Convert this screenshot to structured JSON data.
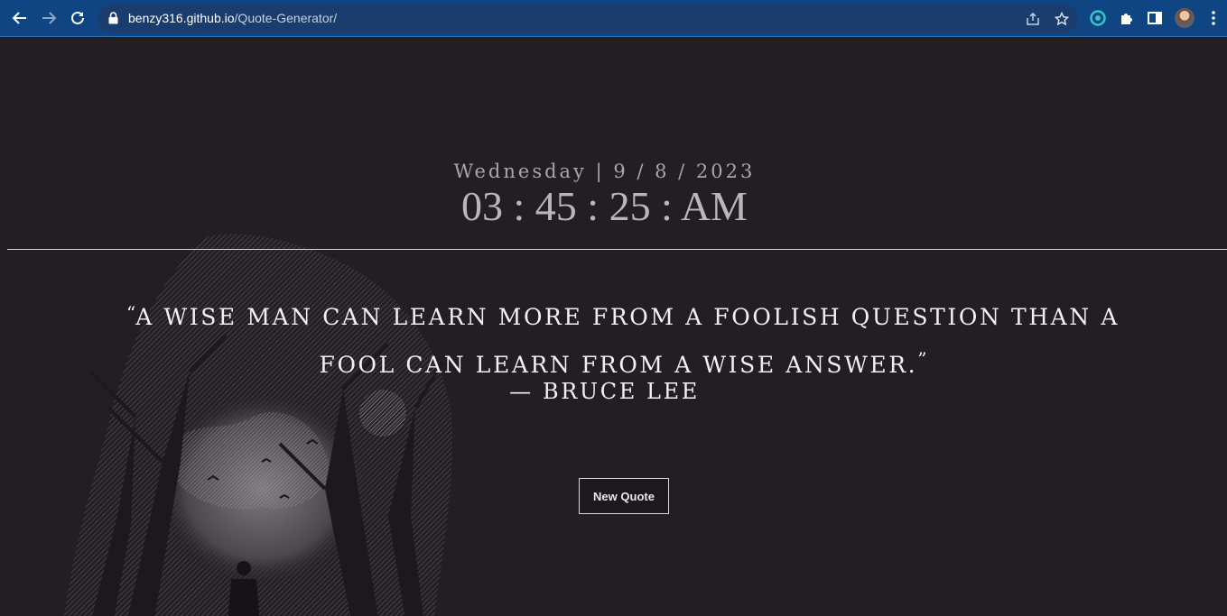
{
  "browser": {
    "url_host": "benzy316.github.io",
    "url_path": "/Quote-Generator/",
    "icons": [
      "back-icon",
      "forward-icon",
      "reload-icon",
      "lock-icon",
      "share-icon",
      "star-icon",
      "extension-icon",
      "puzzle-icon",
      "side-panel-icon",
      "avatar",
      "menu-icon"
    ]
  },
  "clock": {
    "date": "Wednesday | 9 / 8 / 2023",
    "time": "03 : 45 : 25 : AM"
  },
  "quote": {
    "open_mark": "“",
    "text": "A wise man can learn more from a foolish question than a fool can learn from a wise answer.",
    "close_mark": "”",
    "author": "— Bruce Lee"
  },
  "actions": {
    "new_quote_label": "New Quote"
  },
  "colors": {
    "chrome": "#0f4583",
    "background": "#221f24",
    "text": "#f2f0f2"
  }
}
